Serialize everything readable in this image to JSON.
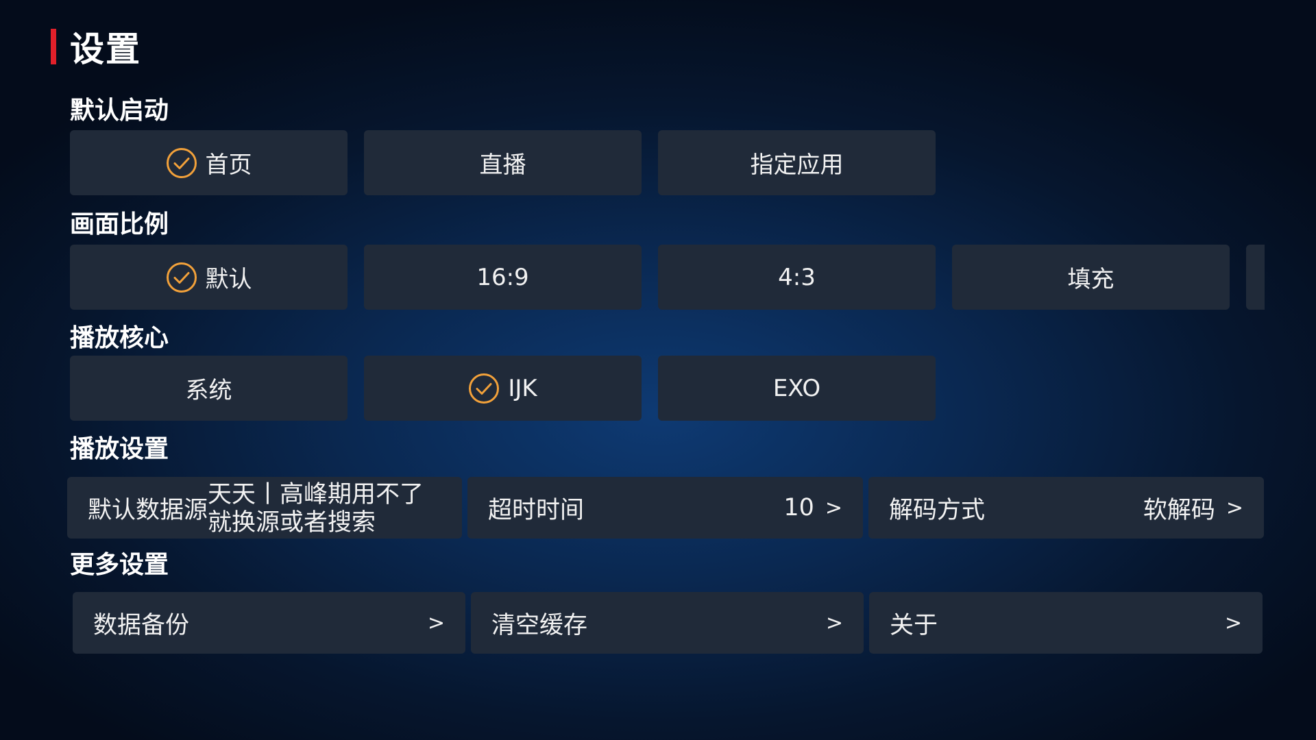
{
  "header": {
    "title": "设置"
  },
  "accent_color": "#e1202a",
  "check_color": "#f2a13a",
  "sections": {
    "default_launch": {
      "label": "默认启动",
      "options": [
        {
          "label": "首页",
          "selected": true
        },
        {
          "label": "直播",
          "selected": false
        },
        {
          "label": "指定应用",
          "selected": false
        }
      ]
    },
    "aspect_ratio": {
      "label": "画面比例",
      "options": [
        {
          "label": "默认",
          "selected": true
        },
        {
          "label": "16:9",
          "selected": false
        },
        {
          "label": "4:3",
          "selected": false
        },
        {
          "label": "填充",
          "selected": false
        }
      ]
    },
    "player_core": {
      "label": "播放核心",
      "options": [
        {
          "label": "系统",
          "selected": false
        },
        {
          "label": "IJK",
          "selected": true
        },
        {
          "label": "EXO",
          "selected": false
        }
      ]
    },
    "playback": {
      "label": "播放设置",
      "items": [
        {
          "label": "默认数据源",
          "value": "天天丨高峰期用不了就换源或者搜索"
        },
        {
          "label": "超时时间",
          "value": "10",
          "arrow": ">"
        },
        {
          "label": "解码方式",
          "value": "软解码",
          "arrow": ">"
        }
      ]
    },
    "more": {
      "label": "更多设置",
      "items": [
        {
          "label": "数据备份",
          "arrow": ">"
        },
        {
          "label": "清空缓存",
          "arrow": ">"
        },
        {
          "label": "关于",
          "arrow": ">"
        }
      ]
    }
  },
  "icons": {
    "selected": "check-circle-icon"
  }
}
